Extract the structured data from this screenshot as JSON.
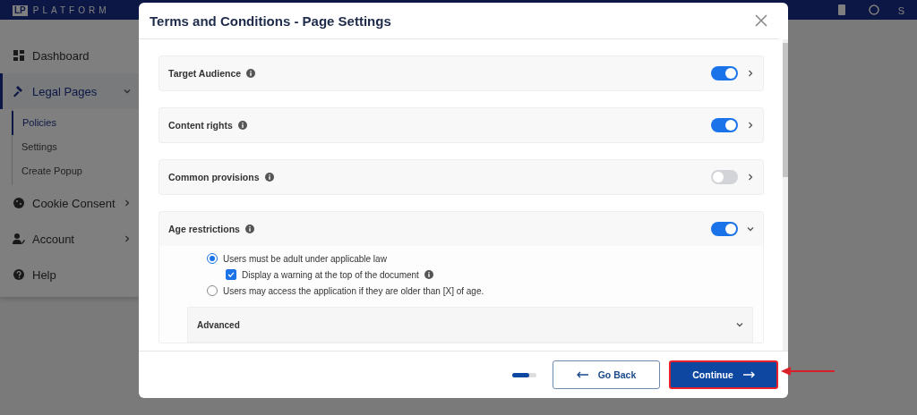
{
  "header": {
    "logo_badge": "LP",
    "logo_text": "PLATFORM",
    "avatar_initial": "S"
  },
  "sidebar": {
    "items": [
      {
        "label": "Dashboard",
        "kind": "link",
        "selected": false
      },
      {
        "label": "Legal Pages",
        "kind": "group",
        "selected": true,
        "expanded": true,
        "children": [
          {
            "label": "Policies",
            "selected": true
          },
          {
            "label": "Settings",
            "selected": false
          },
          {
            "label": "Create Popup",
            "selected": false
          }
        ]
      },
      {
        "label": "Cookie Consent",
        "kind": "group",
        "selected": false,
        "expanded": false
      },
      {
        "label": "Account",
        "kind": "group",
        "selected": false,
        "expanded": false
      },
      {
        "label": "Help",
        "kind": "link",
        "selected": false
      }
    ]
  },
  "modal": {
    "title": "Terms and Conditions - Page Settings",
    "sections": [
      {
        "label": "Target Audience",
        "on": true,
        "expanded": false
      },
      {
        "label": "Content rights",
        "on": true,
        "expanded": false
      },
      {
        "label": "Common provisions",
        "on": false,
        "expanded": false
      },
      {
        "label": "Age restrictions",
        "on": true,
        "expanded": true,
        "options": [
          {
            "kind": "radio",
            "label": "Users must be adult under applicable law",
            "checked": true,
            "children": [
              {
                "kind": "checkbox",
                "label": "Display a warning at the top of the document",
                "checked": true
              }
            ]
          },
          {
            "kind": "radio",
            "label": "Users may access the application if they are older than [X] of age.",
            "checked": false
          }
        ],
        "advanced": {
          "label": "Advanced",
          "expanded": false
        }
      }
    ],
    "footer": {
      "progress": {
        "level": 0.7
      },
      "back_button": "Go Back",
      "continue_button": "Continue"
    }
  }
}
